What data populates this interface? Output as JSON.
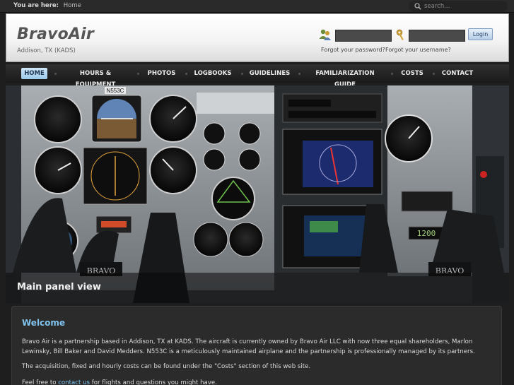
{
  "topbar": {
    "you_are_here": "You are here:",
    "breadcrumb": "Home",
    "search_placeholder": "search..."
  },
  "header": {
    "site_title": "BravoAir",
    "tagline": "Addison, TX (KADS)",
    "login_label": "Login",
    "forgot_password": "Forgot your password?",
    "forgot_username": "Forgot your username?"
  },
  "nav": {
    "items": [
      {
        "label": "HOME",
        "active": true
      },
      {
        "label": "HOURS & EQUIPMENT"
      },
      {
        "label": "PHOTOS"
      },
      {
        "label": "LOGBOOKS"
      },
      {
        "label": "GUIDELINES"
      },
      {
        "label": "FAMILIARIZATION GUIDE"
      },
      {
        "label": "COSTS"
      },
      {
        "label": "CONTACT"
      }
    ]
  },
  "hero": {
    "caption": "Main panel view",
    "tail_number": "N553C",
    "yoke_label": "BRAVO",
    "transponder_code": "1200"
  },
  "content": {
    "heading": "Welcome",
    "paragraph1": "Bravo Air is a partnership based in Addison, TX at KADS. The aircraft is currently owned by Bravo Air LLC with now three equal shareholders, Marlon Lewinsky, Bill Baker and David Medders. N553C is a meticulously maintained airplane and the partnership is professionally managed by its partners.",
    "paragraph2": "The acquisition, fixed and hourly costs can be found under the \"Costs\" section of this web site.",
    "paragraph3_prefix": "Feel free to ",
    "paragraph3_link": "contact us",
    "paragraph3_suffix": " for flights and questions you might have."
  },
  "colors": {
    "accent": "#7fc3ee",
    "nav_active": "#9ccbeb",
    "background": "#1e1e1e"
  }
}
